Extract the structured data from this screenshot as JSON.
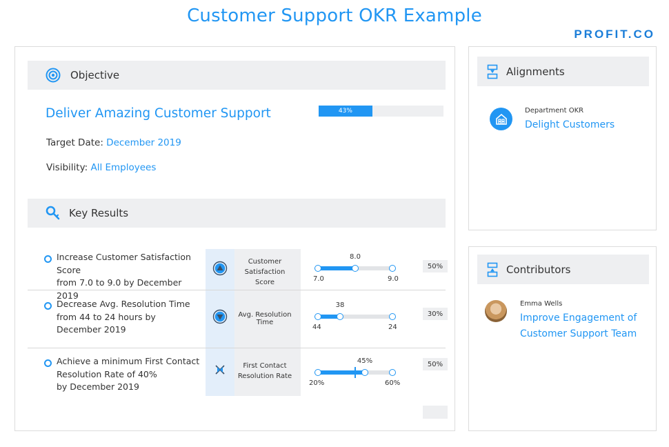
{
  "page": {
    "title": "Customer Support OKR Example",
    "brand": "PROFIT.CO"
  },
  "objective": {
    "section_label": "Objective",
    "title": "Deliver Amazing Customer Support",
    "progress_label": "43%",
    "progress_fraction": 0.43,
    "target_date_label": "Target Date:",
    "target_date_value": "December 2019",
    "visibility_label": "Visibility:",
    "visibility_value": "All Employees"
  },
  "key_results": {
    "section_label": "Key Results",
    "items": [
      {
        "lines": [
          "Increase Customer Satisfaction Score",
          "from 7.0 to 9.0 by December 2019"
        ],
        "icon": "arrow-up-icon",
        "metric_lines": [
          "Customer",
          "Satisfaction Score"
        ],
        "start_label": "7.0",
        "target_label": "9.0",
        "current_label": "8.0",
        "current_fraction": 0.5,
        "percent": "50%"
      },
      {
        "lines": [
          "Decrease Avg. Resolution Time",
          "from 44 to 24 hours by",
          "December 2019"
        ],
        "icon": "arrow-down-icon",
        "metric_lines": [
          "Avg. Resolution",
          "Time"
        ],
        "start_label": "44",
        "target_label": "24",
        "current_label": "38",
        "current_fraction": 0.3,
        "percent": "30%"
      },
      {
        "lines": [
          "Achieve a minimum First Contact",
          "Resolution Rate of 40%",
          "by December 2019"
        ],
        "icon": "threshold-icon",
        "metric_lines": [
          "First Contact",
          "Resolution Rate"
        ],
        "start_label": "20%",
        "target_label": "60%",
        "current_label": "45%",
        "current_fraction": 0.625,
        "threshold_fraction": 0.5,
        "percent": "50%"
      }
    ]
  },
  "alignments": {
    "section_label": "Alignments",
    "caption": "Department OKR",
    "link": "Delight Customers"
  },
  "contributors": {
    "section_label": "Contributors",
    "name": "Emma Wells",
    "link_lines": [
      "Improve Engagement of",
      "Customer Support Team"
    ]
  },
  "colors": {
    "accent": "#2196f3",
    "header_bg": "#eeeff1"
  }
}
